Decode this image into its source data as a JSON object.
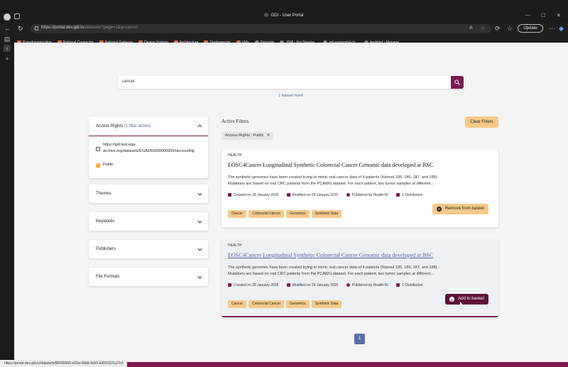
{
  "browser": {
    "window_title": "GDI - User Portal",
    "url_host": "https://portal.dev.gdi.lu",
    "url_path": "/datasets?page=1&q=cancer",
    "update_label": "Update",
    "bookmarks": [
      {
        "label": "Pseudonymization",
        "icon": "gitlab-icon"
      },
      {
        "label": "National Connector",
        "icon": "gitlab-icon"
      },
      {
        "label": "National Gateway",
        "icon": "gitlab-icon"
      },
      {
        "label": "Design System",
        "icon": "gitlab-icon"
      },
      {
        "label": "Architecture",
        "icon": "gitlab-icon"
      },
      {
        "label": "Deployments",
        "icon": "gitlab-icon"
      },
      {
        "label": "VMs",
        "icon": "gitlab-icon"
      },
      {
        "label": "Personio",
        "icon": "personio-icon"
      },
      {
        "label": "JSM - Jira Service...",
        "icon": "jira-icon"
      },
      {
        "label": "gdi-userportal-ck...",
        "icon": "github-icon"
      },
      {
        "label": "deskbird - Manage...",
        "icon": "deskbird-icon"
      }
    ],
    "status_url": "https://portal.dev.gdi.lu/datasets/88439950-e29a-43dd-9cb9-d3091521a714"
  },
  "search": {
    "query": "cancer",
    "result_count": "1 dataset found"
  },
  "filters": {
    "access_rights": {
      "title": "Access Rights",
      "active_note": "(1 filter active)",
      "options": [
        {
          "label": "https://gdi.test.ega-archive.org/datasets/EGAD50000000955#accessRig",
          "checked": false
        },
        {
          "label": "Public",
          "checked": true
        }
      ]
    },
    "collapsed": [
      "Themes",
      "Keywords",
      "Publishers",
      "File Formats"
    ]
  },
  "active_filters": {
    "title": "Active Filters",
    "clear_label": "Clear Filters",
    "chips": [
      "Access Rights : Public"
    ]
  },
  "cards": [
    {
      "category": "HEALTH",
      "title": "EOSC4Cancer Longitudinal Synthetic Colorectal Cancer Genomic data developed at BSC",
      "desc_line1": "The synthetic genomes have been created trying to mimic real cancer data of 4 patients (Named 185, 186, 187, and 188).",
      "desc_line2": "Mutations are based on real CRC patients from the PCAWG dataset. For each patient, two tumor samples at different...",
      "created": "Created on 29 January 2025",
      "modified": "Modified on 29 January 2025",
      "publisher": "Published by Health-RI",
      "distributions": "1 Distribution",
      "tags": [
        "Cancer",
        "Colorectal Cancer",
        "Genomics",
        "Synthetic Data"
      ],
      "basket_label": "Remove from basket"
    },
    {
      "category": "HEALTH",
      "title": "EOSC4Cancer Longitudinal Synthetic Colorectal Cancer Genomic data developed at BSC",
      "desc_line1": "The synthetic genomes have been created trying to mimic real cancer data of 4 patients (Named 185, 186, 187, and 188).",
      "desc_line2": "Mutations are based on real CRC patients from the PCAWG dataset. For each patient, two tumor samples at different...",
      "created": "Created on 29 January 2025",
      "modified": "Modified on 29 January 2025",
      "publisher": "Published by Health-RI",
      "distributions": "1 Distribution",
      "tags": [
        "Cancer",
        "Colorectal Cancer",
        "Genomics",
        "Synthetic Data"
      ],
      "basket_label": "Add to basket"
    }
  ],
  "pagination": {
    "current": "1"
  },
  "colors": {
    "brand": "#7a1a4f",
    "accent": "#f8c98a",
    "pager": "#5a6fa8"
  }
}
